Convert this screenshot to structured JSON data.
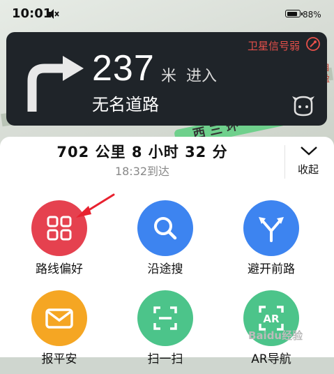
{
  "status_bar": {
    "time": "10:01",
    "battery": "88%",
    "battery_level": 0.88
  },
  "map": {
    "road_label": "西 三 环",
    "side_label": "自 盈"
  },
  "navigation": {
    "distance": "237",
    "unit": "米",
    "action": "进入",
    "road_name": "无名道路",
    "gps_warning": "卫星信号弱"
  },
  "trip": {
    "summary": "702 公里  8 小时 32 分",
    "arrival": "18:32到达",
    "collapse_label": "收起"
  },
  "actions": [
    {
      "label": "路线偏好",
      "icon": "route-preference-icon",
      "color": "#e5414f"
    },
    {
      "label": "沿途搜",
      "icon": "search-icon",
      "color": "#3d84f0"
    },
    {
      "label": "避开前路",
      "icon": "avoid-road-icon",
      "color": "#3d84f0"
    },
    {
      "label": "报平安",
      "icon": "mail-icon",
      "color": "#f5a623"
    },
    {
      "label": "扫一扫",
      "icon": "scan-icon",
      "color": "#4cc48a"
    },
    {
      "label": "AR导航",
      "icon": "ar-icon",
      "color": "#4cc48a"
    }
  ],
  "watermark": "Baidu经验"
}
